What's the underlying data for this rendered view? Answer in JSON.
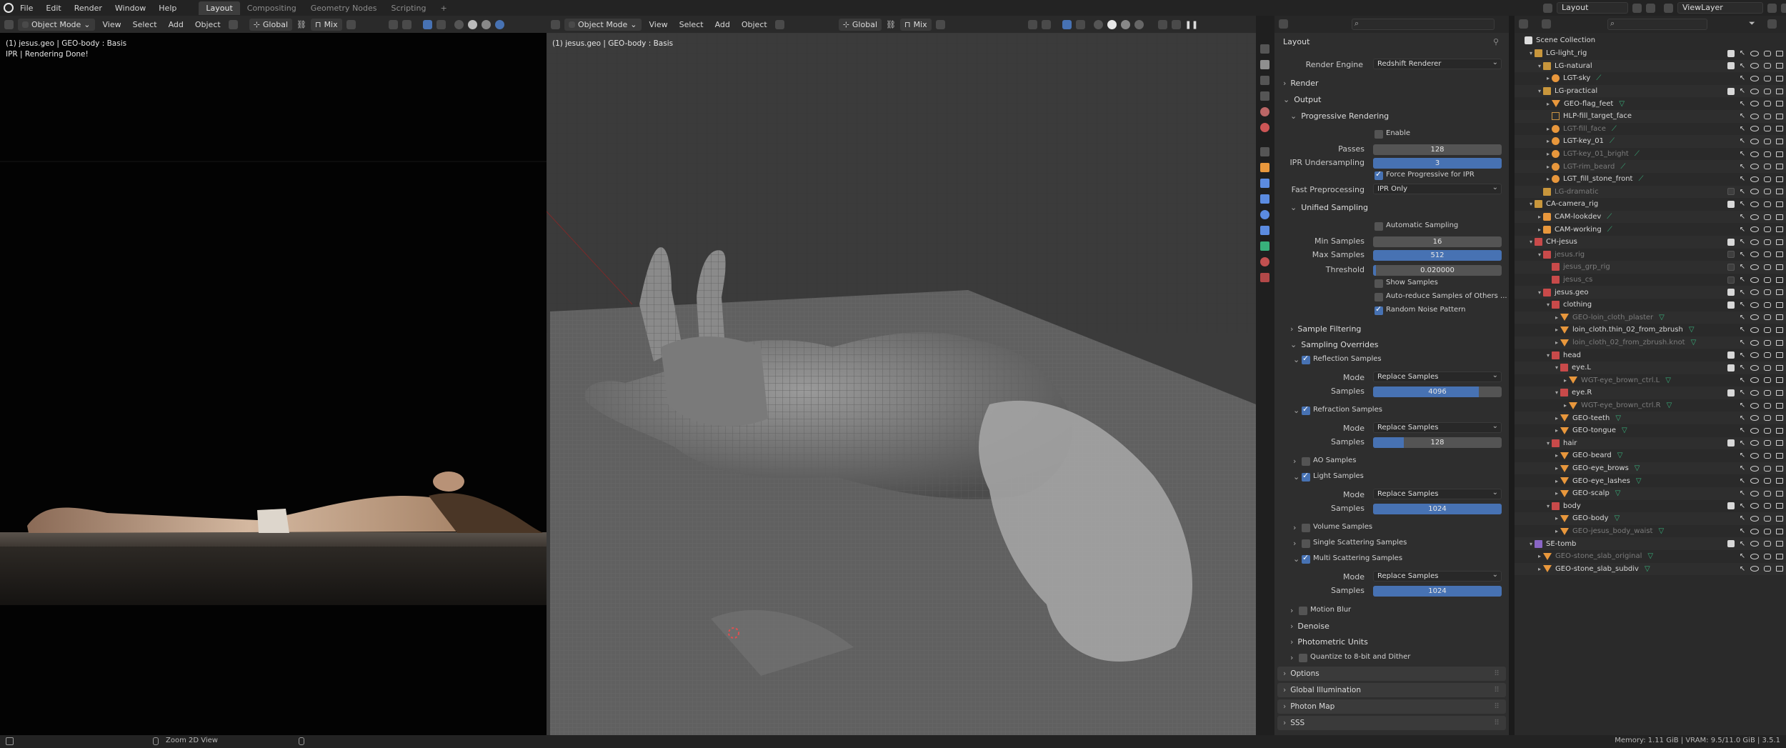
{
  "menu": {
    "items": [
      "File",
      "Edit",
      "Render",
      "Window",
      "Help"
    ],
    "tabs": [
      "Layout",
      "Compositing",
      "Geometry Nodes",
      "Scripting"
    ],
    "active_tab": "Layout",
    "add_tab": "+",
    "scene": "Layout",
    "view_layer": "ViewLayer"
  },
  "left_editor": {
    "mode": "Object Mode",
    "menus": [
      "View",
      "Select",
      "Add",
      "Object"
    ],
    "orientation": "Global",
    "snap": "Mix",
    "info_line1": "(1) jesus.geo | GEO-body : Basis",
    "info_line2": "IPR | Rendering Done!"
  },
  "right_editor": {
    "mode": "Object Mode",
    "menus": [
      "View",
      "Select",
      "Add",
      "Object"
    ],
    "orientation": "Global",
    "snap": "Mix",
    "info_line1": "(1) jesus.geo | GEO-body : Basis"
  },
  "properties": {
    "header": "Layout",
    "render_engine_label": "Render Engine",
    "render_engine": "Redshift Renderer",
    "sections": {
      "render": "Render",
      "output": "Output",
      "progressive": "Progressive Rendering",
      "enable": "Enable",
      "passes_label": "Passes",
      "passes": "128",
      "ipr_label": "IPR Undersampling",
      "ipr": "3",
      "force_progressive": "Force Progressive for IPR",
      "fast_pre_label": "Fast Preprocessing",
      "fast_pre": "IPR Only",
      "unified": "Unified Sampling",
      "auto_sampling": "Automatic Sampling",
      "min_samples_label": "Min Samples",
      "min_samples": "16",
      "max_samples_label": "Max Samples",
      "max_samples": "512",
      "threshold_label": "Threshold",
      "threshold": "0.020000",
      "show_samples": "Show Samples",
      "auto_reduce": "Auto-reduce Samples of Others ...",
      "random_noise": "Random Noise Pattern",
      "sample_filtering": "Sample Filtering",
      "sampling_overrides": "Sampling Overrides",
      "reflection": "Reflection Samples",
      "mode_label": "Mode",
      "replace": "Replace Samples",
      "samples_label": "Samples",
      "reflection_samples": "4096",
      "refraction": "Refraction Samples",
      "refraction_samples": "128",
      "ao": "AO Samples",
      "light": "Light Samples",
      "light_samples": "1024",
      "volume": "Volume Samples",
      "single_scatter": "Single Scattering Samples",
      "multi_scatter": "Multi Scattering Samples",
      "multi_samples": "1024",
      "motion_blur": "Motion Blur",
      "denoise": "Denoise",
      "photometric": "Photometric Units",
      "quantize": "Quantize to 8-bit and Dither",
      "options": "Options",
      "gi": "Global Illumination",
      "photon_map": "Photon Map",
      "sss": "SSS"
    }
  },
  "outliner": {
    "root": "Scene Collection",
    "rows": [
      {
        "label": "LG-light_rig",
        "depth": 1,
        "icon": "coll",
        "dim": false
      },
      {
        "label": "LG-natural",
        "depth": 2,
        "icon": "coll",
        "dim": false
      },
      {
        "label": "LGT-sky",
        "depth": 3,
        "icon": "light",
        "dim": false
      },
      {
        "label": "LG-practical",
        "depth": 2,
        "icon": "coll",
        "dim": false
      },
      {
        "label": "GEO-flag_feet",
        "depth": 3,
        "icon": "mesh",
        "dim": false
      },
      {
        "label": "HLP-fill_target_face",
        "depth": 3,
        "icon": "empty",
        "dim": false
      },
      {
        "label": "LGT-fill_face",
        "depth": 3,
        "icon": "light",
        "dim": true
      },
      {
        "label": "LGT-key_01",
        "depth": 3,
        "icon": "light",
        "dim": false
      },
      {
        "label": "LGT-key_01_bright",
        "depth": 3,
        "icon": "light",
        "dim": true
      },
      {
        "label": "LGT-rim_beard",
        "depth": 3,
        "icon": "light",
        "dim": true
      },
      {
        "label": "LGT_fill_stone_front",
        "depth": 3,
        "icon": "light",
        "dim": false
      },
      {
        "label": "LG-dramatic",
        "depth": 2,
        "icon": "coll",
        "dim": true
      },
      {
        "label": "CA-camera_rig",
        "depth": 1,
        "icon": "coll",
        "dim": false
      },
      {
        "label": "CAM-lookdev",
        "depth": 2,
        "icon": "cam",
        "dim": false
      },
      {
        "label": "CAM-working",
        "depth": 2,
        "icon": "cam",
        "dim": false
      },
      {
        "label": "CH-jesus",
        "depth": 1,
        "icon": "collr",
        "dim": false
      },
      {
        "label": "jesus.rig",
        "depth": 2,
        "icon": "collr",
        "dim": true
      },
      {
        "label": "jesus_grp_rig",
        "depth": 3,
        "icon": "collr",
        "dim": true
      },
      {
        "label": "jesus_cs",
        "depth": 3,
        "icon": "collr",
        "dim": true
      },
      {
        "label": "jesus.geo",
        "depth": 2,
        "icon": "collr",
        "dim": false
      },
      {
        "label": "clothing",
        "depth": 3,
        "icon": "collr",
        "dim": false
      },
      {
        "label": "GEO-loin_cloth_plaster",
        "depth": 4,
        "icon": "mesh",
        "dim": true
      },
      {
        "label": "loin_cloth.thin_02_from_zbrush",
        "depth": 4,
        "icon": "mesh",
        "dim": false
      },
      {
        "label": "loin_cloth_02_from_zbrush.knot",
        "depth": 4,
        "icon": "mesh",
        "dim": true
      },
      {
        "label": "head",
        "depth": 3,
        "icon": "collr",
        "dim": false
      },
      {
        "label": "eye.L",
        "depth": 4,
        "icon": "collr",
        "dim": false
      },
      {
        "label": "WGT-eye_brown_ctrl.L",
        "depth": 5,
        "icon": "mesh",
        "dim": true
      },
      {
        "label": "eye.R",
        "depth": 4,
        "icon": "collr",
        "dim": false
      },
      {
        "label": "WGT-eye_brown_ctrl.R",
        "depth": 5,
        "icon": "mesh",
        "dim": true
      },
      {
        "label": "GEO-teeth",
        "depth": 4,
        "icon": "mesh",
        "dim": false
      },
      {
        "label": "GEO-tongue",
        "depth": 4,
        "icon": "mesh",
        "dim": false
      },
      {
        "label": "hair",
        "depth": 3,
        "icon": "collr",
        "dim": false
      },
      {
        "label": "GEO-beard",
        "depth": 4,
        "icon": "mesh",
        "dim": false
      },
      {
        "label": "GEO-eye_brows",
        "depth": 4,
        "icon": "mesh",
        "dim": false
      },
      {
        "label": "GEO-eye_lashes",
        "depth": 4,
        "icon": "mesh",
        "dim": false
      },
      {
        "label": "GEO-scalp",
        "depth": 4,
        "icon": "mesh",
        "dim": false
      },
      {
        "label": "body",
        "depth": 3,
        "icon": "collr",
        "dim": false
      },
      {
        "label": "GEO-body",
        "depth": 4,
        "icon": "mesh",
        "dim": false
      },
      {
        "label": "GEO-jesus_body_waist",
        "depth": 4,
        "icon": "mesh",
        "dim": true
      },
      {
        "label": "SE-tomb",
        "depth": 1,
        "icon": "collp",
        "dim": false
      },
      {
        "label": "GEO-stone_slab_original",
        "depth": 2,
        "icon": "mesh",
        "dim": true
      },
      {
        "label": "GEO-stone_slab_subdiv",
        "depth": 2,
        "icon": "mesh",
        "dim": false
      }
    ]
  },
  "status": {
    "hint": "Zoom 2D View",
    "memory": "Memory: 1.11 GiB | VRAM: 9.5/11.0 GiB | 3.5.1"
  }
}
